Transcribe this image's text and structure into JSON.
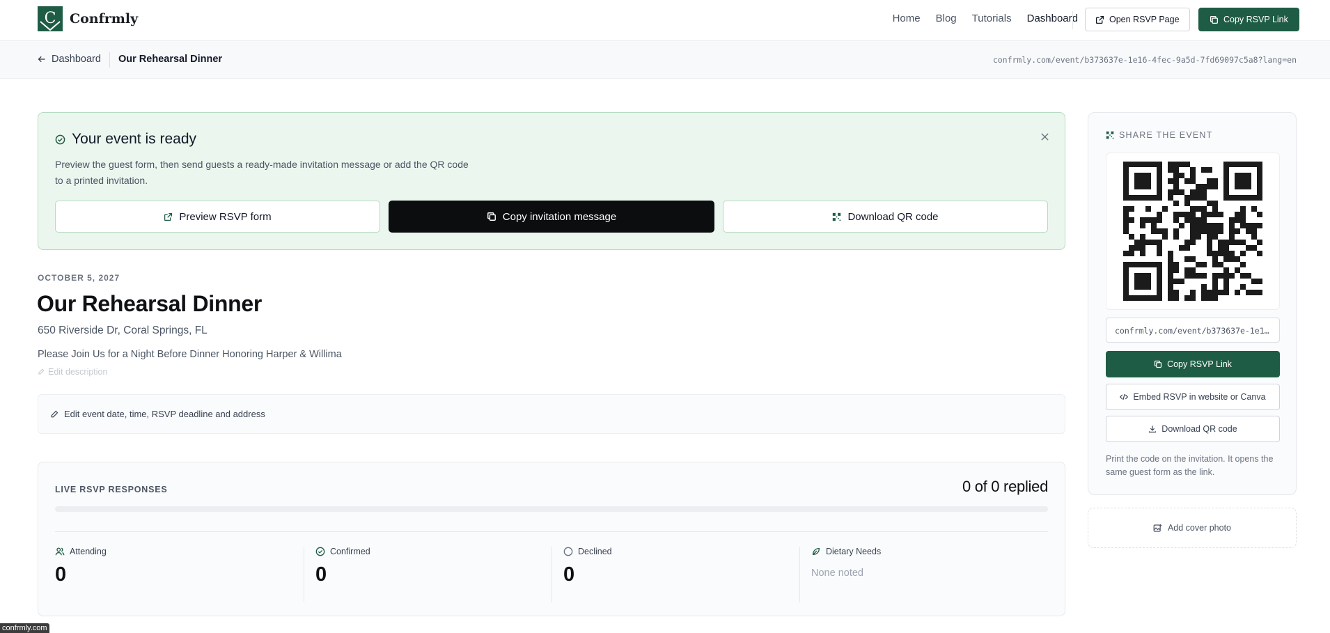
{
  "nav": {
    "brand": "Confrmly",
    "links": [
      "Home",
      "Blog",
      "Tutorials",
      "Dashboard"
    ],
    "active_link": "Dashboard",
    "open_rsvp_label": "Open RSVP Page",
    "copy_rsvp_label": "Copy RSVP Link",
    "accent_color": "#1f5c45"
  },
  "breadcrumb": {
    "back_label": "Dashboard",
    "current": "Our Rehearsal Dinner",
    "url": "confrmly.com/event/b373637e-1e16-4fec-9a5d-7fd69097c5a8?lang=en"
  },
  "banner": {
    "title": "Your event is ready",
    "description": "Preview the guest form, then send guests a ready-made invitation message or add the QR code to a printed invitation.",
    "buttons": {
      "preview": "Preview RSVP form",
      "copy_invite": "Copy invitation message",
      "download_qr": "Download QR code"
    },
    "background_color": "#ebf6ee"
  },
  "event": {
    "date": "OCTOBER 5, 2027",
    "title": "Our Rehearsal Dinner",
    "address": "650 Riverside Dr, Coral Springs, FL",
    "description": "Please Join Us for a Night Before Dinner Honoring Harper & Willima",
    "edit_description_label": "Edit description",
    "edit_details_label": "Edit event date, time, RSVP deadline and address"
  },
  "responses": {
    "label": "LIVE RSVP RESPONSES",
    "summary": "0 of 0 replied",
    "replied_fraction": 0,
    "stats": {
      "attending": {
        "label": "Attending",
        "value": "0"
      },
      "confirmed": {
        "label": "Confirmed",
        "value": "0"
      },
      "declined": {
        "label": "Declined",
        "value": "0"
      },
      "dietary": {
        "label": "Dietary Needs",
        "value": "None noted"
      }
    }
  },
  "share": {
    "label": "SHARE THE EVENT",
    "url": "confrmly.com/event/b373637e-1e16-4fec-9a5d-7fd69097c5a8",
    "copy_link": "Copy RSVP Link",
    "embed": "Embed RSVP in website or Canva",
    "download_qr": "Download QR code",
    "note": "Print the code on the invitation. It opens the same guest form as the link.",
    "add_cover": "Add cover photo"
  },
  "status_tooltip": "confrmly.com"
}
